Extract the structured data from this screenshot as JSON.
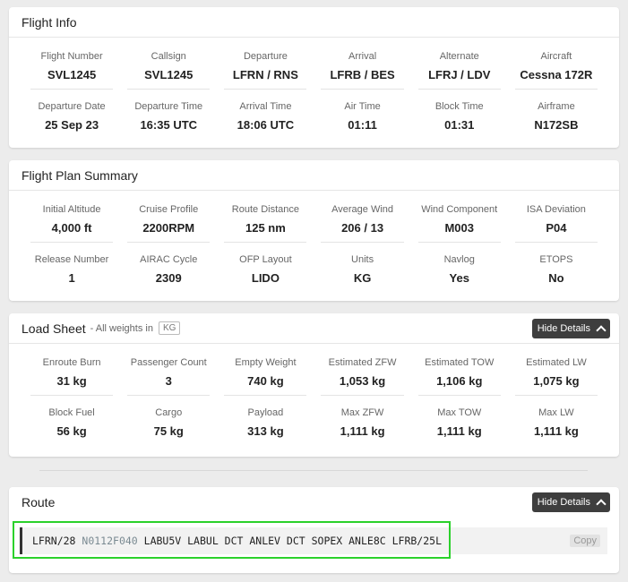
{
  "flight_info": {
    "title": "Flight Info",
    "row1": [
      {
        "label": "Flight Number",
        "value": "SVL1245"
      },
      {
        "label": "Callsign",
        "value": "SVL1245"
      },
      {
        "label": "Departure",
        "value": "LFRN / RNS"
      },
      {
        "label": "Arrival",
        "value": "LFRB / BES"
      },
      {
        "label": "Alternate",
        "value": "LFRJ / LDV"
      },
      {
        "label": "Aircraft",
        "value": "Cessna 172R"
      }
    ],
    "row2": [
      {
        "label": "Departure Date",
        "value": "25 Sep 23"
      },
      {
        "label": "Departure Time",
        "value": "16:35 UTC"
      },
      {
        "label": "Arrival Time",
        "value": "18:06 UTC"
      },
      {
        "label": "Air Time",
        "value": "01:11"
      },
      {
        "label": "Block Time",
        "value": "01:31"
      },
      {
        "label": "Airframe",
        "value": "N172SB"
      }
    ]
  },
  "flight_plan": {
    "title": "Flight Plan Summary",
    "row1": [
      {
        "label": "Initial Altitude",
        "value": "4,000 ft"
      },
      {
        "label": "Cruise Profile",
        "value": "2200RPM"
      },
      {
        "label": "Route Distance",
        "value": "125 nm"
      },
      {
        "label": "Average Wind",
        "value": "206 / 13"
      },
      {
        "label": "Wind Component",
        "value": "M003"
      },
      {
        "label": "ISA Deviation",
        "value": "P04"
      }
    ],
    "row2": [
      {
        "label": "Release Number",
        "value": "1"
      },
      {
        "label": "AIRAC Cycle",
        "value": "2309"
      },
      {
        "label": "OFP Layout",
        "value": "LIDO"
      },
      {
        "label": "Units",
        "value": "KG"
      },
      {
        "label": "Navlog",
        "value": "Yes"
      },
      {
        "label": "ETOPS",
        "value": "No"
      }
    ]
  },
  "load_sheet": {
    "title": "Load Sheet",
    "subnote": "- All weights in",
    "unit_chip": "KG",
    "hide_label": "Hide Details",
    "row1": [
      {
        "label": "Enroute Burn",
        "value": "31 kg"
      },
      {
        "label": "Passenger Count",
        "value": "3"
      },
      {
        "label": "Empty Weight",
        "value": "740 kg"
      },
      {
        "label": "Estimated ZFW",
        "value": "1,053 kg"
      },
      {
        "label": "Estimated TOW",
        "value": "1,106 kg"
      },
      {
        "label": "Estimated LW",
        "value": "1,075 kg"
      }
    ],
    "row2": [
      {
        "label": "Block Fuel",
        "value": "56 kg"
      },
      {
        "label": "Cargo",
        "value": "75 kg"
      },
      {
        "label": "Payload",
        "value": "313 kg"
      },
      {
        "label": "Max ZFW",
        "value": "1,111 kg"
      },
      {
        "label": "Max TOW",
        "value": "1,111 kg"
      },
      {
        "label": "Max LW",
        "value": "1,111 kg"
      }
    ]
  },
  "route": {
    "title": "Route",
    "hide_label": "Hide Details",
    "origin": "LFRN/28",
    "speed_level": "N0112F040",
    "rest": "LABU5V LABUL DCT ANLEV DCT SOPEX ANLE8C LFRB/25L",
    "copy_label": "Copy"
  },
  "colors": {
    "highlight_border": "#2bd12b",
    "button_bg": "#3e3e3e",
    "page_bg": "#ececec"
  }
}
